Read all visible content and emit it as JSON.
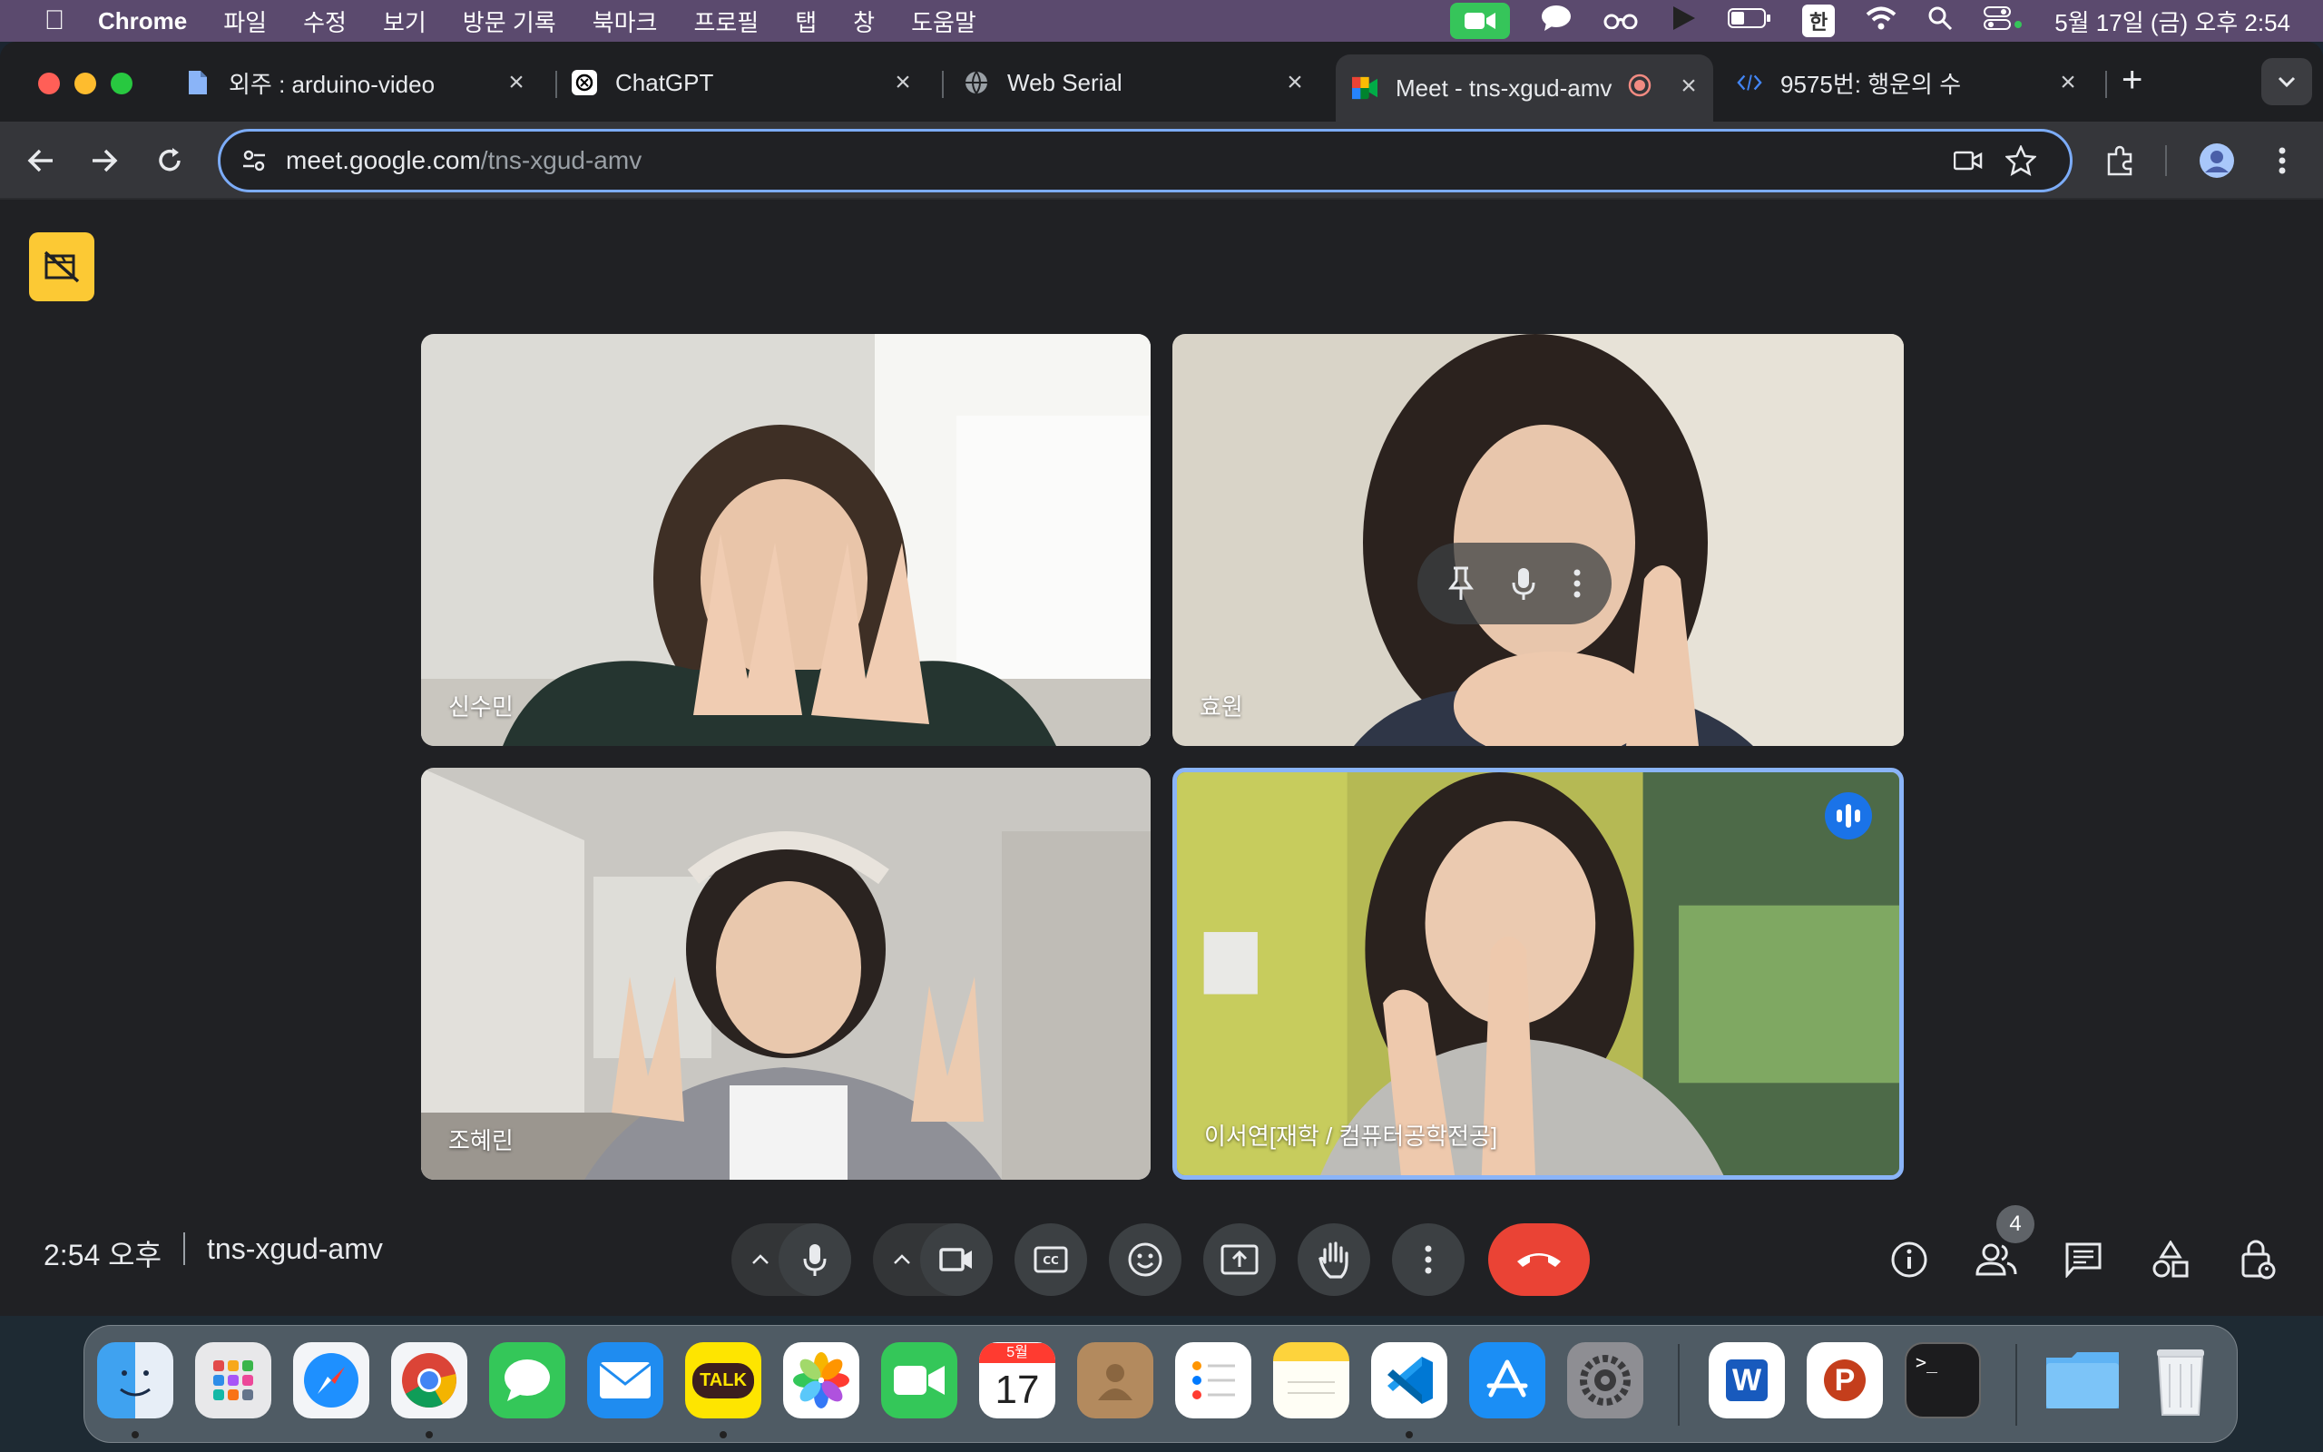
{
  "menubar": {
    "app_name": "Chrome",
    "items": [
      "파일",
      "수정",
      "보기",
      "방문 기록",
      "북마크",
      "프로필",
      "탭",
      "창",
      "도움말"
    ],
    "input_method": "한",
    "clock": "5월 17일 (금) 오후 2:54"
  },
  "tabs": [
    {
      "title": "외주 : arduino-video",
      "favicon": "document-icon"
    },
    {
      "title": "ChatGPT",
      "favicon": "chatgpt-icon"
    },
    {
      "title": "Web Serial",
      "favicon": "globe-icon"
    },
    {
      "title": "Meet - tns-xgud-amv",
      "favicon": "meet-icon",
      "active": true
    },
    {
      "title": "9575번: 행운의 수",
      "favicon": "code-icon"
    }
  ],
  "address": {
    "host": "meet.google.com",
    "path": "/tns-xgud-amv"
  },
  "participants": [
    {
      "name": "신수민"
    },
    {
      "name": "효원"
    },
    {
      "name": "조혜린"
    },
    {
      "name": "이서연[재학 / 컴퓨터공학전공]",
      "speaking": true
    }
  ],
  "meeting": {
    "time": "2:54 오후",
    "code": "tns-xgud-amv",
    "people_count": "4"
  },
  "colors": {
    "leave": "#ea4335",
    "speaking_border": "#8ab4f8",
    "lock_badge": "#fcc934"
  },
  "dock": {
    "calendar_month": "5월",
    "calendar_day": "17",
    "kakaotalk_label": "TALK",
    "word_letter": "W",
    "powerpoint_letter": "P",
    "terminal_prompt": ">_"
  }
}
